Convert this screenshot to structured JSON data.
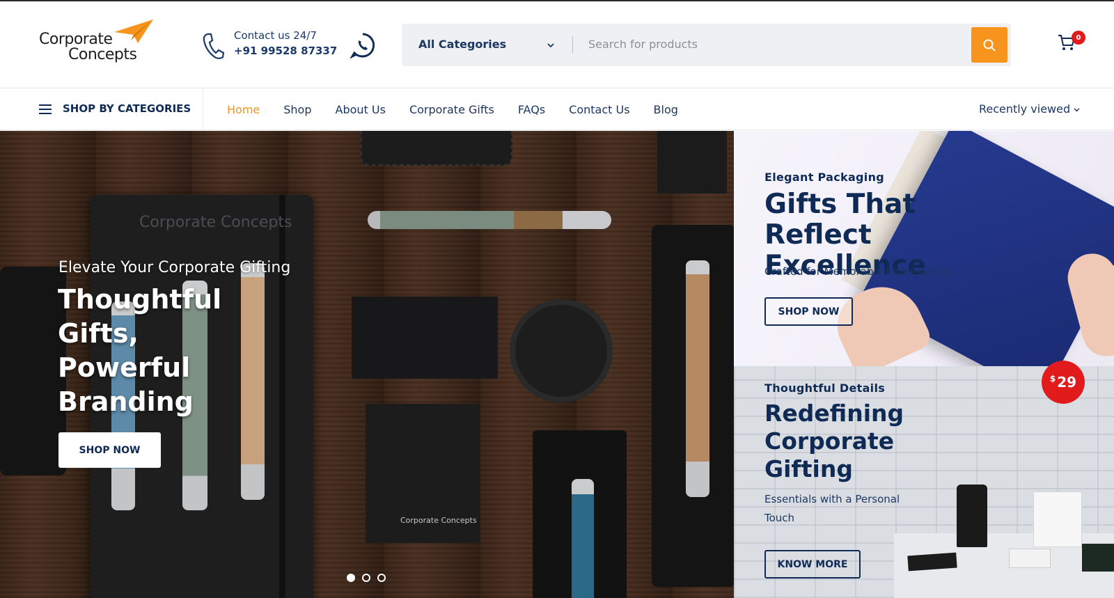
{
  "brand": {
    "logo_line1": "Corporate",
    "logo_line2": "Concepts",
    "accent": "#f7941d",
    "navy": "#0f2a55"
  },
  "header": {
    "contact_label": "Contact us 24/7",
    "contact_number": "+91 99528 87337",
    "phone_icon": "phone-icon",
    "whatsapp_icon": "whatsapp-icon",
    "search": {
      "category_selected": "All Categories",
      "placeholder": "Search for products",
      "button_icon": "search-icon"
    },
    "cart": {
      "icon": "cart-icon",
      "count": "0"
    }
  },
  "nav": {
    "shop_by_categories": "SHOP BY CATEGORIES",
    "items": [
      {
        "label": "Home",
        "active": true
      },
      {
        "label": "Shop"
      },
      {
        "label": "About Us"
      },
      {
        "label": "Corporate Gifts"
      },
      {
        "label": "FAQs"
      },
      {
        "label": "Contact Us"
      },
      {
        "label": "Blog"
      }
    ],
    "recently_viewed": "Recently viewed"
  },
  "hero": {
    "subtitle": "Elevate Your Corporate Gifting",
    "title": "Thoughtful Gifts, Powerful Branding",
    "button": "SHOP NOW",
    "slides": 3,
    "active_slide": 1,
    "product_brand_text": "Corporate Concepts"
  },
  "promo1": {
    "kicker": "Elegant Packaging",
    "title": "Gifts That Reflect Excellence",
    "description": "Crafted for Memorable Impressions",
    "button": "SHOP NOW"
  },
  "promo2": {
    "kicker": "Thoughtful Details",
    "title": "Redefining Corporate Gifting",
    "description": "Essentials with a Personal Touch",
    "button": "KNOW MORE",
    "price_currency": "$",
    "price_amount": "29",
    "price_color": "#e11b1b"
  }
}
